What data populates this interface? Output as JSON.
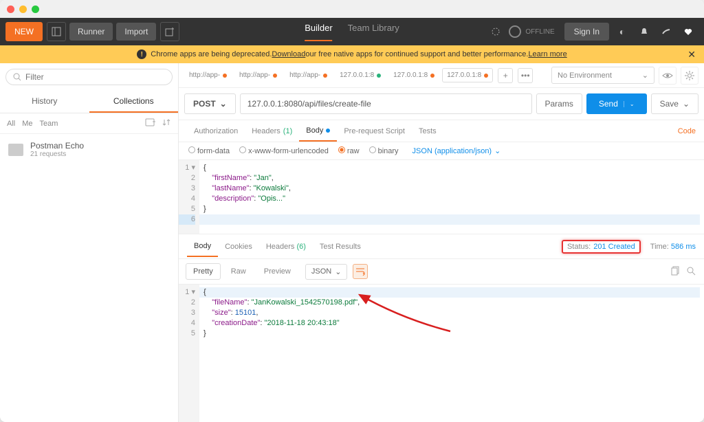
{
  "window": {
    "new_btn": "NEW",
    "runner_btn": "Runner",
    "import_btn": "Import",
    "builder_tab": "Builder",
    "team_tab": "Team Library",
    "offline": "OFFLINE",
    "signin": "Sign In"
  },
  "banner": {
    "prefix": "Chrome apps are being deprecated. ",
    "download": "Download",
    "mid": " our free native apps for continued support and better performance. ",
    "learn": "Learn more"
  },
  "sidebar": {
    "filter_ph": "Filter",
    "history_tab": "History",
    "collections_tab": "Collections",
    "scope": {
      "all": "All",
      "me": "Me",
      "team": "Team"
    },
    "collection": {
      "name": "Postman Echo",
      "sub": "21 requests"
    }
  },
  "tabs": [
    {
      "label": "http://app-"
    },
    {
      "label": "http://app-"
    },
    {
      "label": "http://app-"
    },
    {
      "label": "127.0.0.1:8"
    },
    {
      "label": "127.0.0.1:8"
    },
    {
      "label": "127.0.0.1:8"
    }
  ],
  "env": {
    "none": "No Environment"
  },
  "request": {
    "method": "POST",
    "url": "127.0.0.1:8080/api/files/create-file",
    "params_btn": "Params",
    "send_btn": "Send",
    "save_btn": "Save"
  },
  "subtabs": {
    "auth": "Authorization",
    "headers": "Headers",
    "headers_n": "(1)",
    "body": "Body",
    "prs": "Pre-request Script",
    "tests": "Tests",
    "code": "Code"
  },
  "bodytypes": {
    "form": "form-data",
    "xwww": "x-www-form-urlencoded",
    "raw": "raw",
    "binary": "binary",
    "json": "JSON (application/json)"
  },
  "req_body": {
    "l1": "{",
    "k1": "\"firstName\"",
    "v1": "\"Jan\"",
    "k2": "\"lastName\"",
    "v2": "\"Kowalski\"",
    "k3": "\"description\"",
    "v3": "\"Opis...\"",
    "l5": "}"
  },
  "resp_tabs": {
    "body": "Body",
    "cookies": "Cookies",
    "headers": "Headers",
    "headers_n": "(6)",
    "tests": "Test Results"
  },
  "status": {
    "label": "Status:",
    "value": "201 Created"
  },
  "time": {
    "label": "Time:",
    "value": "586 ms"
  },
  "view": {
    "pretty": "Pretty",
    "raw": "Raw",
    "preview": "Preview",
    "json": "JSON"
  },
  "resp_body": {
    "l1": "{",
    "k1": "\"fileName\"",
    "v1": "\"JanKowalski_1542570198.pdf\"",
    "k2": "\"size\"",
    "v2": "15101",
    "k3": "\"creationDate\"",
    "v3": "\"2018-11-18 20:43:18\"",
    "l5": "}"
  }
}
